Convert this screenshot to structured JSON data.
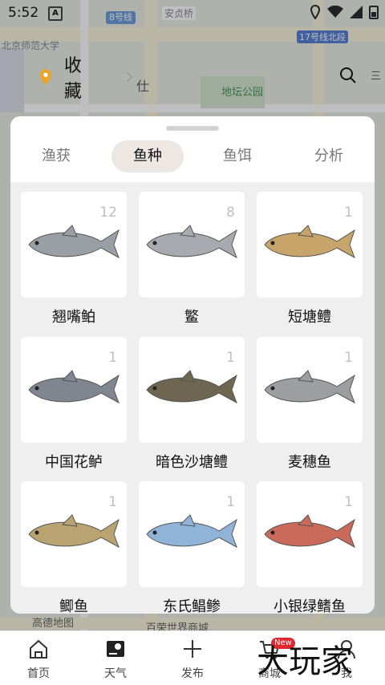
{
  "status_bar": {
    "time": "5:52",
    "notif": "A"
  },
  "map": {
    "labels": [
      "北京师范大学",
      "安贞桥",
      "地坛公园",
      "百荣世界商城",
      "高德地图",
      "17号线北段",
      "8号线",
      "仕",
      "三"
    ],
    "metro": "8号线"
  },
  "header": {
    "favorites_label": "收藏"
  },
  "sheet": {
    "tabs": [
      {
        "label": "渔获",
        "active": false
      },
      {
        "label": "鱼种",
        "active": true
      },
      {
        "label": "鱼饵",
        "active": false
      },
      {
        "label": "分析",
        "active": false
      }
    ],
    "fish": [
      {
        "name": "翘嘴鲌",
        "count": "12",
        "color": "#9a9fa6"
      },
      {
        "name": "鳘",
        "count": "8",
        "color": "#a8aab0"
      },
      {
        "name": "短塘鳢",
        "count": "1",
        "color": "#c7a56a"
      },
      {
        "name": "中国花鲈",
        "count": "1",
        "color": "#808690"
      },
      {
        "name": "暗色沙塘鳢",
        "count": "1",
        "color": "#6e6650"
      },
      {
        "name": "麦穗鱼",
        "count": "1",
        "color": "#9c9ea0"
      },
      {
        "name": "鲫鱼",
        "count": "1",
        "color": "#b9a370"
      },
      {
        "name": "东氏鲳鲹",
        "count": "1",
        "color": "#8fb4d8"
      },
      {
        "name": "小银绿鳍鱼",
        "count": "1",
        "color": "#c96a5a"
      }
    ]
  },
  "nav": [
    {
      "label": "首页",
      "icon": "home-icon"
    },
    {
      "label": "天气",
      "icon": "weather-icon"
    },
    {
      "label": "发布",
      "icon": "plus-icon"
    },
    {
      "label": "商城",
      "icon": "cart-icon",
      "badge": "New"
    },
    {
      "label": "我",
      "icon": "profile-icon"
    }
  ],
  "watermark": "大玩家"
}
